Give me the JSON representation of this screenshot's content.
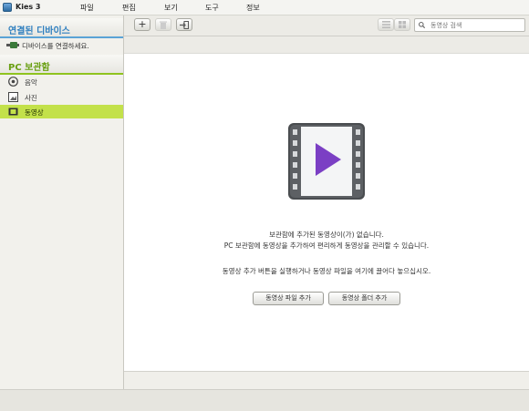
{
  "app": {
    "title": "Kies 3"
  },
  "menu": [
    "파일",
    "편집",
    "보기",
    "도구",
    "정보"
  ],
  "sidebar": {
    "devices_header": "연결된 디바이스",
    "connect_prompt": "디바이스를 연결하세요.",
    "pc_header": "PC 보관함",
    "items": [
      {
        "label": "음악",
        "icon": "music-icon"
      },
      {
        "label": "사진",
        "icon": "photo-icon"
      },
      {
        "label": "동영상",
        "icon": "video-icon",
        "selected": true
      }
    ]
  },
  "toolbar": {
    "add_label": "+",
    "delete_label": "🗑",
    "export_label": "⇥",
    "search_placeholder": "동영상 검색"
  },
  "main": {
    "empty_line1": "보관함에 추가된 동영상이(가) 없습니다.",
    "empty_line2": "PC 보관함에 동영상을 추가하여 편리하게 동영상을 관리할 수 있습니다.",
    "empty_line3": "동영상 추가 버튼을 실행하거나 동영상 파일을 여기에 끌어다 놓으십시오.",
    "add_file_button": "동영상 파일 추가",
    "add_folder_button": "동영상 폴더 추가"
  },
  "colors": {
    "selected_row": "#c3e14a",
    "devices_accent": "#2f7fbf",
    "pc_accent": "#6aa013",
    "play_purple": "#7b3fc4"
  }
}
